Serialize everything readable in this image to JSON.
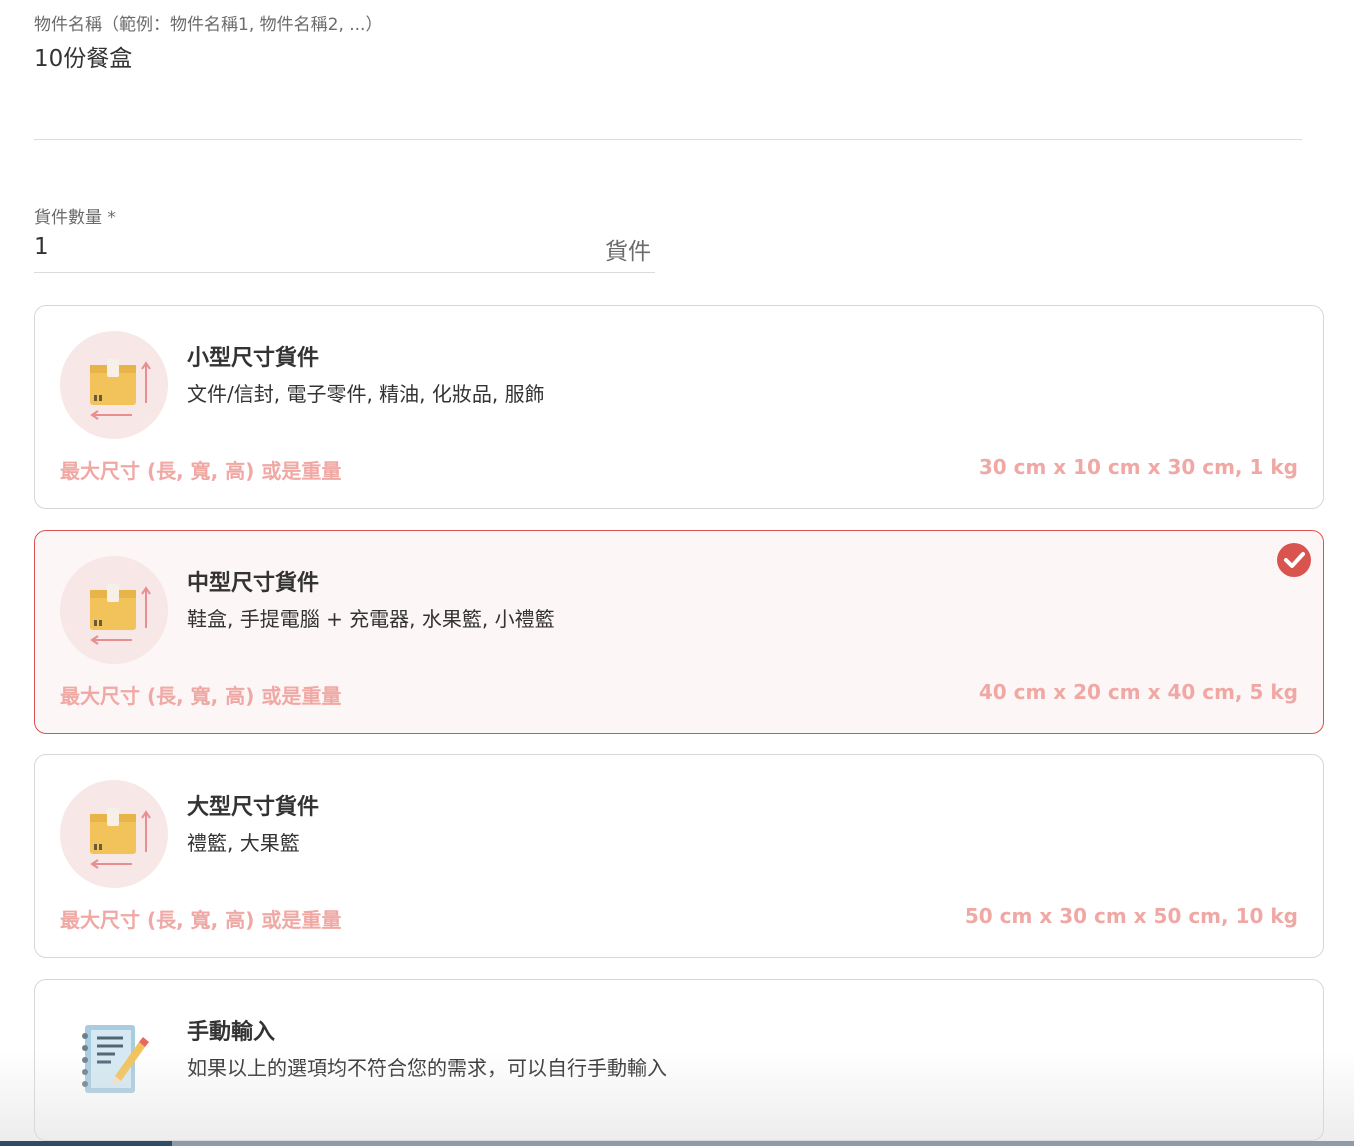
{
  "item_name": {
    "label": "物件名稱（範例：物件名稱1, 物件名稱2, ...）",
    "value": "10份餐盒"
  },
  "quantity": {
    "label": "貨件數量 *",
    "value": "1",
    "unit": "貨件"
  },
  "size_options": [
    {
      "title": "小型尺寸貨件",
      "description": "文件/信封, 電子零件, 精油, 化妝品, 服飾",
      "max_label": "最大尺寸 (長, 寬, 高) 或是重量",
      "max_value": "30 cm x 10 cm x 30 cm, 1 kg",
      "icon": "package-icon",
      "selected": false
    },
    {
      "title": "中型尺寸貨件",
      "description": "鞋盒, 手提電腦 + 充電器, 水果籃, 小禮籃",
      "max_label": "最大尺寸 (長, 寬, 高) 或是重量",
      "max_value": "40 cm x 20 cm x 40 cm, 5 kg",
      "icon": "package-icon",
      "selected": true
    },
    {
      "title": "大型尺寸貨件",
      "description": "禮籃, 大果籃",
      "max_label": "最大尺寸 (長, 寬, 高) 或是重量",
      "max_value": "50 cm x 30 cm x 50 cm, 10 kg",
      "icon": "package-icon",
      "selected": false
    }
  ],
  "manual_option": {
    "title": "手動輸入",
    "description": "如果以上的選項均不符合您的需求，可以自行手動輸入",
    "icon": "notepad-pencil-icon"
  },
  "colors": {
    "accent": "#d9534f",
    "selected_bg": "#fcf7f6",
    "dimension_text": "#f0a8a4"
  }
}
